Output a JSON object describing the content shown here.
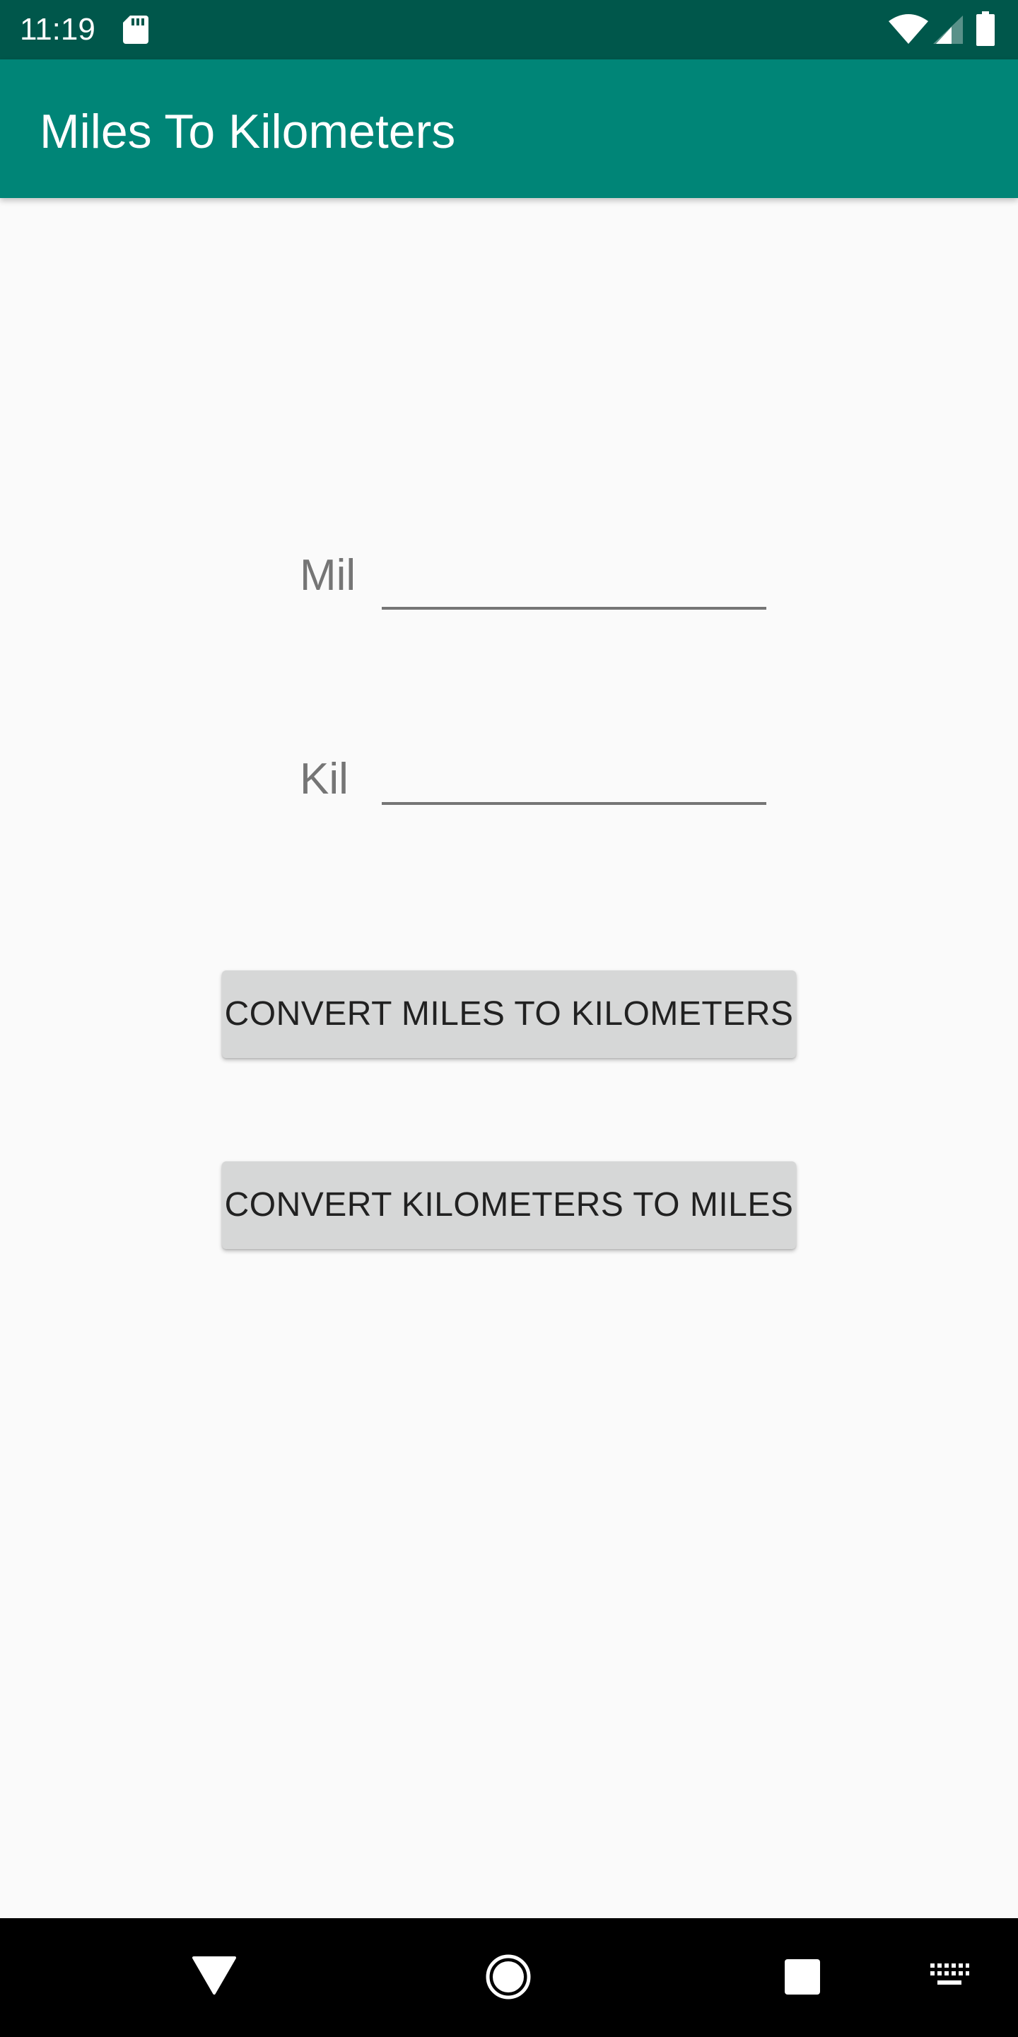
{
  "status_bar": {
    "time": "11:19",
    "icons": [
      "sd-card-icon",
      "wifi-icon",
      "signal-icon",
      "battery-icon"
    ]
  },
  "app_bar": {
    "title": "Miles To Kilometers",
    "color": "#008577"
  },
  "form": {
    "miles_label": "Mil",
    "miles_value": "",
    "kilometers_label": "Kil",
    "kilometers_value": ""
  },
  "buttons": {
    "miles_to_km": "CONVERT MILES TO KILOMETERS",
    "km_to_miles": "CONVERT KILOMETERS TO MILES"
  },
  "nav_bar": {
    "icons": [
      "back-icon",
      "home-icon",
      "recents-icon",
      "keyboard-icon"
    ]
  },
  "colors": {
    "status_bar": "#00574b",
    "app_bar": "#008577",
    "background": "#fafafa",
    "button": "#d6d7d7",
    "label": "#757575"
  }
}
